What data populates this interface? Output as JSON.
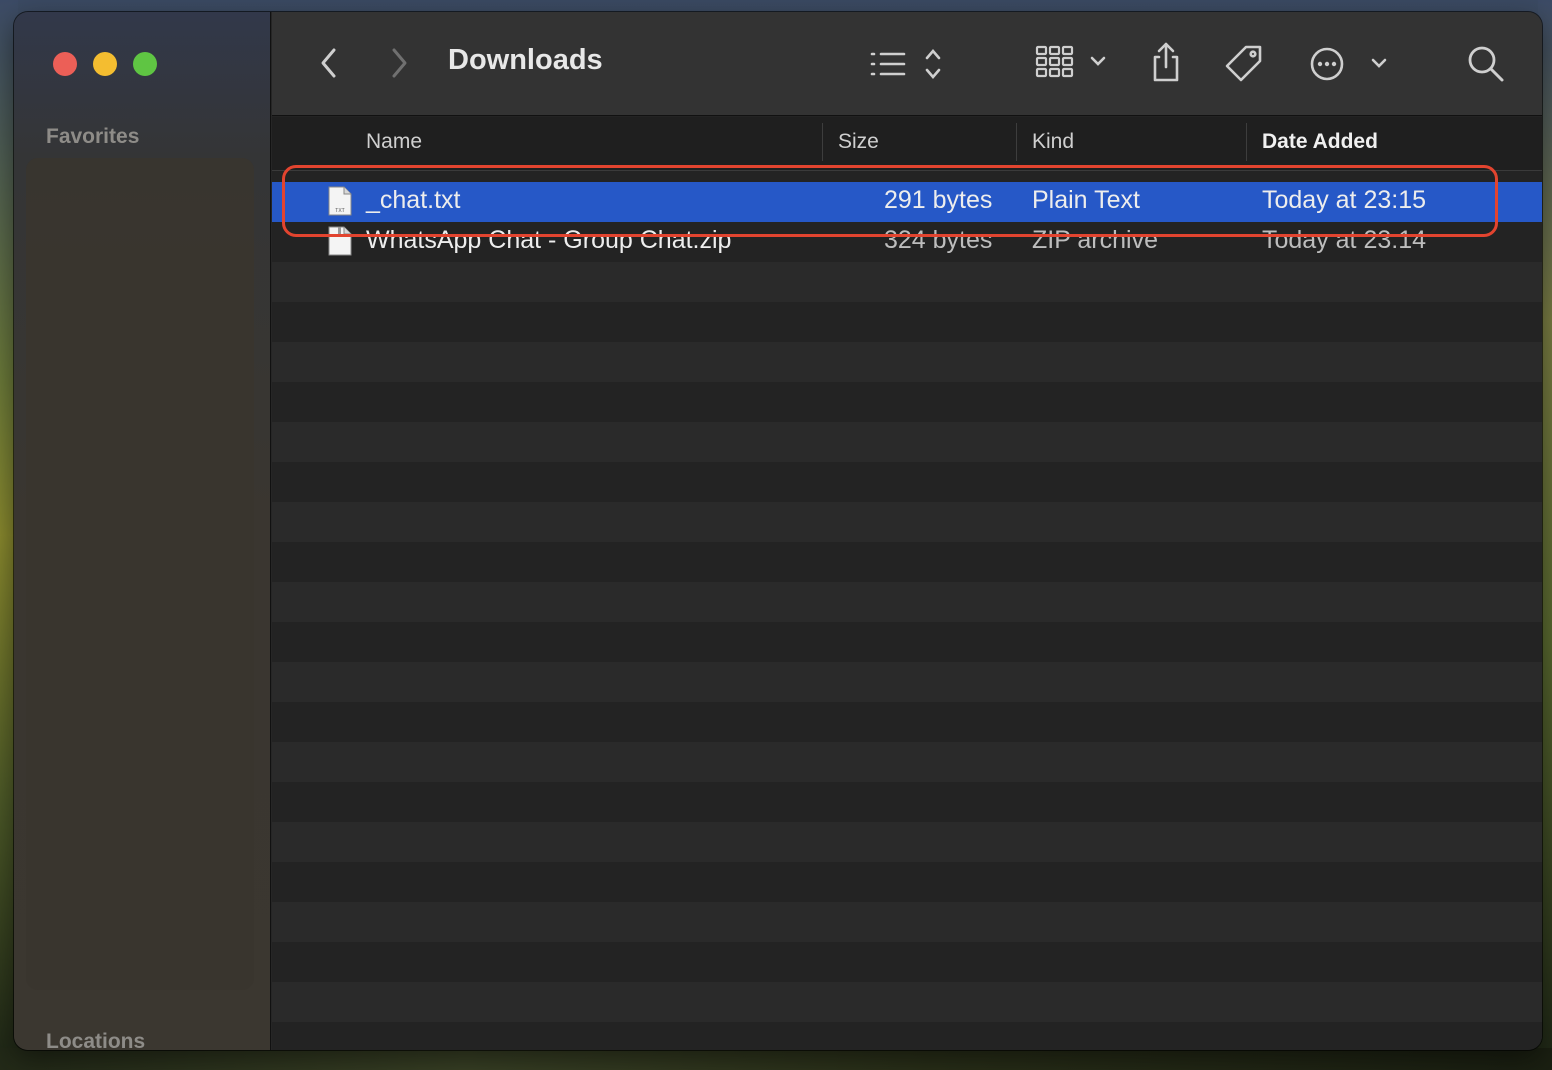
{
  "window": {
    "title": "Downloads"
  },
  "sidebar": {
    "section_favorites": "Favorites",
    "section_locations": "Locations"
  },
  "toolbar": {
    "back_icon": "chevron-left-icon",
    "forward_icon": "chevron-right-icon",
    "list_view_icon": "list-icon",
    "group_icon": "grid-icon",
    "share_icon": "share-icon",
    "tag_icon": "tag-icon",
    "more_icon": "ellipsis-circle-icon",
    "search_icon": "search-icon"
  },
  "columns": {
    "name": "Name",
    "size": "Size",
    "kind": "Kind",
    "date_added": "Date Added"
  },
  "files": [
    {
      "name": "_chat.txt",
      "size": "291 bytes",
      "kind": "Plain Text",
      "date_added": "Today at 23:15",
      "selected": true,
      "icon": "txt-file-icon"
    },
    {
      "name": "WhatsApp Chat - Group Chat.zip",
      "size": "324 bytes",
      "kind": "ZIP archive",
      "date_added": "Today at 23:14",
      "selected": false,
      "icon": "zip-file-icon"
    }
  ],
  "colors": {
    "selection": "#2658c7",
    "annotation": "#e2442f"
  }
}
